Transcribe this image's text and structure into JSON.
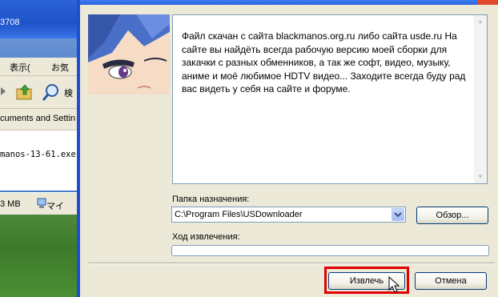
{
  "background_window": {
    "title_fragment": "3708",
    "menu": [
      "表示(",
      "お気"
    ],
    "toolbar_search_label": "検",
    "address": "cuments and Settin",
    "file_name": "manos-13-61.exe",
    "status_size": "3 MB",
    "status_computer": "マイ"
  },
  "dialog": {
    "info_text": "Файл скачан с сайта blackmanos.org.ru либо сайта usde.ru На сайте вы найдёть всегда рабочую версию моей сборки для закачки с разных обменников, а так же софт, видео, музыку, аниме и моё любимое HDTV видео... Заходите всегда буду рад вас видеть у себя на сайте и форуме.",
    "destination_label": "Папка назначения:",
    "destination_value": "C:\\Program Files\\USDownloader",
    "browse_label": "Обзор...",
    "progress_label": "Ход извлечения:",
    "progress": 0,
    "extract_label": "Извлечь",
    "cancel_label": "Отмена"
  },
  "colors": {
    "dialog_bg": "#ece9d8",
    "xp_blue": "#1f4fd0",
    "highlight_red": "#e00000"
  }
}
